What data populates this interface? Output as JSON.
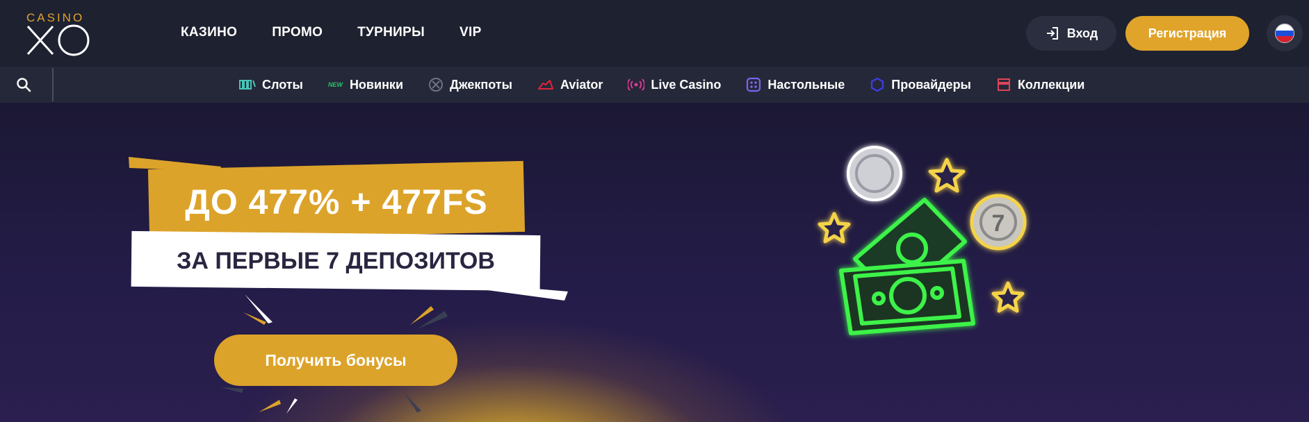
{
  "header": {
    "logo": {
      "top": "CASINO",
      "bottom": "XO"
    },
    "nav": [
      {
        "label": "КАЗИНО"
      },
      {
        "label": "ПРОМО"
      },
      {
        "label": "ТУРНИРЫ"
      },
      {
        "label": "VIP"
      }
    ],
    "login_label": "Вход",
    "register_label": "Регистрация",
    "language": "ru",
    "colors": {
      "accent": "#e0a42b",
      "bar": "#1e2130"
    }
  },
  "categories": [
    {
      "label": "Слоты",
      "icon": "slots-icon",
      "color": "#4fd6c4"
    },
    {
      "label": "Новинки",
      "icon": "new-badge-icon",
      "badge": "NEW",
      "color": "#27c46b"
    },
    {
      "label": "Джекпоты",
      "icon": "jackpot-icon",
      "color": "#6d7184"
    },
    {
      "label": "Aviator",
      "icon": "aviator-plane-icon",
      "color": "#e0263a"
    },
    {
      "label": "Live Casino",
      "icon": "live-broadcast-icon",
      "color": "#e0389a"
    },
    {
      "label": "Настольные",
      "icon": "dice-icon",
      "color": "#7b63f0"
    },
    {
      "label": "Провайдеры",
      "icon": "providers-icon",
      "color": "#3a3de0"
    },
    {
      "label": "Коллекции",
      "icon": "collections-icon",
      "color": "#e0435a"
    }
  ],
  "hero": {
    "title": "ДО 477% + 477FS",
    "subtitle": "ЗА ПЕРВЫЕ 7 ДЕПОЗИТОВ",
    "cta_label": "Получить бонусы",
    "coin_label": "7"
  }
}
